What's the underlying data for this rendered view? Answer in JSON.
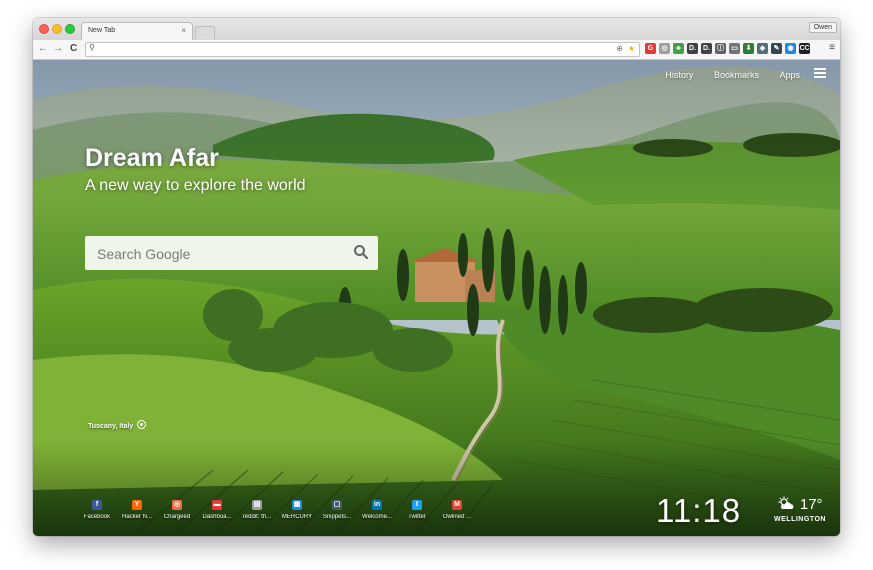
{
  "window": {
    "tab_title": "New Tab",
    "tab_close": "×",
    "profile_name": "Owen"
  },
  "toolbar": {
    "back": "←",
    "forward": "→",
    "reload": "C",
    "menu": "≡"
  },
  "extensions": [
    {
      "name": "g-extension-icon",
      "glyph": "G",
      "color": "#e53935"
    },
    {
      "name": "eye-extension-icon",
      "glyph": "◎",
      "color": "#9e9e9e"
    },
    {
      "name": "evernote-extension-icon",
      "glyph": "♣",
      "color": "#43a047"
    },
    {
      "name": "d-extension-icon",
      "glyph": "D.",
      "color": "#424242"
    },
    {
      "name": "d2-extension-icon",
      "glyph": "D.",
      "color": "#424242"
    },
    {
      "name": "info-extension-icon",
      "glyph": "ⓘ",
      "color": "#616161"
    },
    {
      "name": "cast-extension-icon",
      "glyph": "▭",
      "color": "#757575"
    },
    {
      "name": "download-extension-icon",
      "glyph": "⬇",
      "color": "#2e7d32"
    },
    {
      "name": "pocket-extension-icon",
      "glyph": "◈",
      "color": "#546e7a"
    },
    {
      "name": "feedly-extension-icon",
      "glyph": "✎",
      "color": "#37474f"
    },
    {
      "name": "camera-extension-icon",
      "glyph": "◉",
      "color": "#1e88e5"
    },
    {
      "name": "cc-extension-icon",
      "glyph": "CC",
      "color": "#212121"
    }
  ],
  "nav": {
    "history": "History",
    "bookmarks": "Bookmarks",
    "apps": "Apps"
  },
  "hero": {
    "title": "Dream Afar",
    "tagline": "A new way to explore the world"
  },
  "search": {
    "placeholder": "Search Google"
  },
  "location": "Tuscany, Italy",
  "shortcuts": [
    {
      "label": "Facebook",
      "glyph": "f",
      "color": "#3b5998"
    },
    {
      "label": "Hacker N...",
      "glyph": "Y",
      "color": "#ff6600"
    },
    {
      "label": "Chargeed",
      "glyph": "◎",
      "color": "#ef6c42"
    },
    {
      "label": "Dashboa...",
      "glyph": "▬",
      "color": "#e53935"
    },
    {
      "label": "reddit: th...",
      "glyph": "▤",
      "color": "#9e9e9e"
    },
    {
      "label": "MERCURY",
      "glyph": "▦",
      "color": "#1e88e5"
    },
    {
      "label": "Snippets...",
      "glyph": "▢",
      "color": "#455a64"
    },
    {
      "label": "Welcome...",
      "glyph": "in",
      "color": "#0077b5"
    },
    {
      "label": "Twitter",
      "glyph": "t",
      "color": "#1da1f2"
    },
    {
      "label": "Owlined ...",
      "glyph": "M",
      "color": "#db4437"
    }
  ],
  "clock": "11:18",
  "weather": {
    "temp": "17°",
    "city": "WELLINGTON"
  }
}
